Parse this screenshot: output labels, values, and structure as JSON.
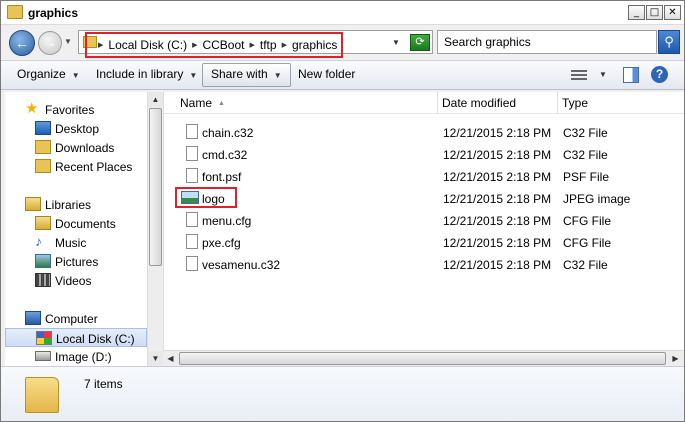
{
  "window": {
    "title": "graphics"
  },
  "address": {
    "crumbs": [
      "Local Disk (C:)",
      "CCBoot",
      "tftp",
      "graphics"
    ]
  },
  "search": {
    "placeholder": "Search graphics"
  },
  "toolbar": {
    "organize": "Organize",
    "include_in_library": "Include in library",
    "share_with": "Share with",
    "new_folder": "New folder"
  },
  "nav": {
    "favorites": "Favorites",
    "desktop": "Desktop",
    "downloads": "Downloads",
    "recent_places": "Recent Places",
    "libraries": "Libraries",
    "documents": "Documents",
    "music": "Music",
    "pictures": "Pictures",
    "videos": "Videos",
    "computer": "Computer",
    "local_disk": "Local Disk (C:)",
    "image_disk": "Image (D:)"
  },
  "columns": {
    "name": "Name",
    "date": "Date modified",
    "type": "Type"
  },
  "files": [
    {
      "name": "chain.c32",
      "date": "12/21/2015 2:18 PM",
      "type": "C32 File"
    },
    {
      "name": "cmd.c32",
      "date": "12/21/2015 2:18 PM",
      "type": "C32 File"
    },
    {
      "name": "font.psf",
      "date": "12/21/2015 2:18 PM",
      "type": "PSF File"
    },
    {
      "name": "logo",
      "date": "12/21/2015 2:18 PM",
      "type": "JPEG image"
    },
    {
      "name": "menu.cfg",
      "date": "12/21/2015 2:18 PM",
      "type": "CFG File"
    },
    {
      "name": "pxe.cfg",
      "date": "12/21/2015 2:18 PM",
      "type": "CFG File"
    },
    {
      "name": "vesamenu.c32",
      "date": "12/21/2015 2:18 PM",
      "type": "C32 File"
    }
  ],
  "details": {
    "item_count": "7 items"
  },
  "colors": {
    "highlight": "#e0202a",
    "selection": "#cfdcf3"
  }
}
